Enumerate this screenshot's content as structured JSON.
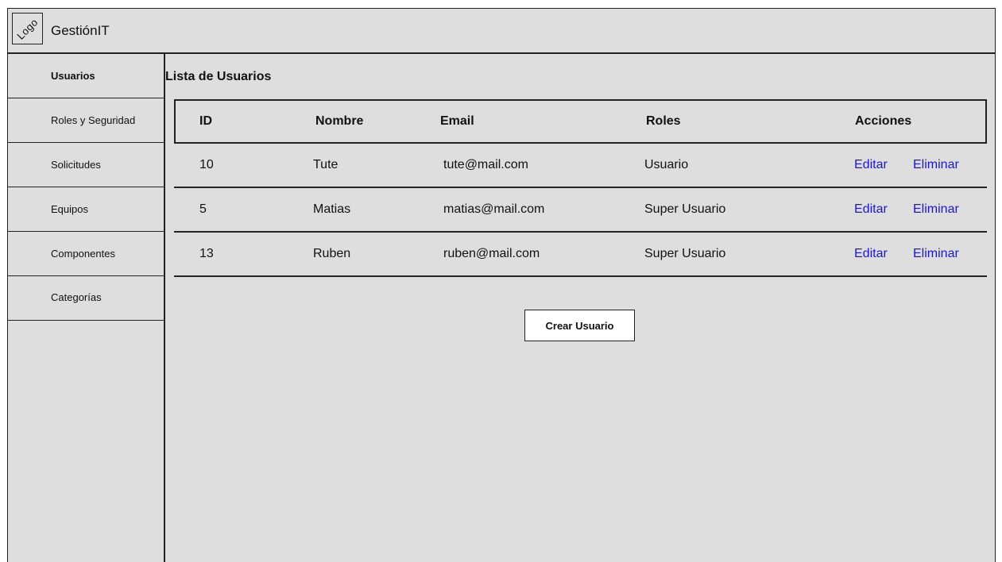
{
  "header": {
    "logo_text": "Logo",
    "app_title": "GestiónIT"
  },
  "sidebar": {
    "items": [
      {
        "label": "Usuarios",
        "active": true
      },
      {
        "label": "Roles y Seguridad"
      },
      {
        "label": "Solicitudes"
      },
      {
        "label": "Equipos"
      },
      {
        "label": "Componentes"
      },
      {
        "label": "Categorías"
      }
    ]
  },
  "main": {
    "title": "Lista de Usuarios",
    "table": {
      "columns": [
        "ID",
        "Nombre",
        "Email",
        "Roles",
        "Acciones"
      ],
      "rows": [
        {
          "id": "10",
          "name": "Tute",
          "email": "tute@mail.com",
          "role": "Usuario",
          "edit": "Editar",
          "delete": "Eliminar"
        },
        {
          "id": "5",
          "name": "Matias",
          "email": "matias@mail.com",
          "role": "Super Usuario",
          "edit": "Editar",
          "delete": "Eliminar"
        },
        {
          "id": "13",
          "name": "Ruben",
          "email": "ruben@mail.com",
          "role": "Super Usuario",
          "edit": "Editar",
          "delete": "Eliminar"
        }
      ]
    },
    "create_button": "Crear Usuario"
  },
  "colors": {
    "background": "#dedede",
    "link": "#1a14e8",
    "border": "#222222"
  }
}
